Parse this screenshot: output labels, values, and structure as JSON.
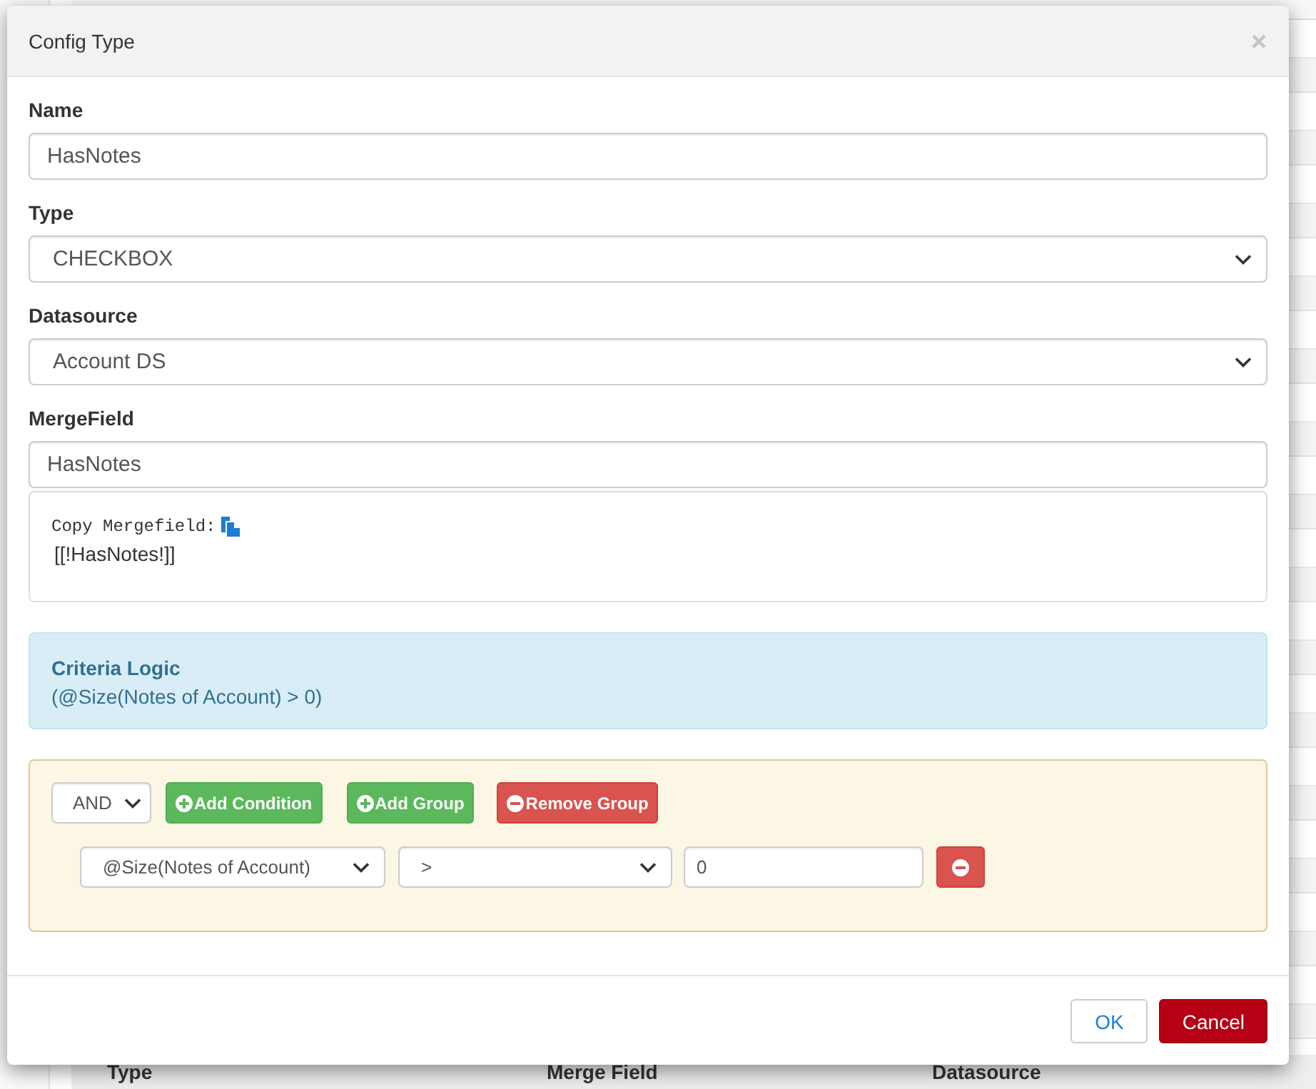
{
  "background_page": {
    "table": {
      "columns": [
        "Type",
        "Merge Field",
        "Datasource"
      ]
    }
  },
  "dialog": {
    "title": "Config Type",
    "fields": [
      {
        "kind": "input",
        "label": "Name",
        "value": "HasNotes"
      },
      {
        "kind": "select",
        "label": "Type",
        "value": "CHECKBOX"
      },
      {
        "kind": "select",
        "label": "Datasource",
        "value": "Account DS"
      },
      {
        "kind": "input",
        "label": "MergeField",
        "value": "HasNotes"
      }
    ],
    "mergefield_copy": {
      "label": "Copy Mergefield:",
      "value": "[[!HasNotes!]]"
    },
    "criteria_logic": {
      "title": "Criteria Logic",
      "expression": "(@Size(Notes of Account) > 0)"
    },
    "query_builder": {
      "conjunction": "AND",
      "buttons": [
        {
          "kind": "add",
          "label": "Add Condition"
        },
        {
          "kind": "add",
          "label": "Add Group"
        },
        {
          "kind": "remove",
          "label": "Remove Group"
        }
      ],
      "rules": [
        {
          "field": "@Size(Notes of Account)",
          "operator": ">",
          "value": "0"
        }
      ]
    },
    "footer": {
      "buttons": [
        {
          "kind": "default",
          "label": "OK"
        },
        {
          "kind": "danger",
          "label": "Cancel"
        }
      ]
    }
  }
}
